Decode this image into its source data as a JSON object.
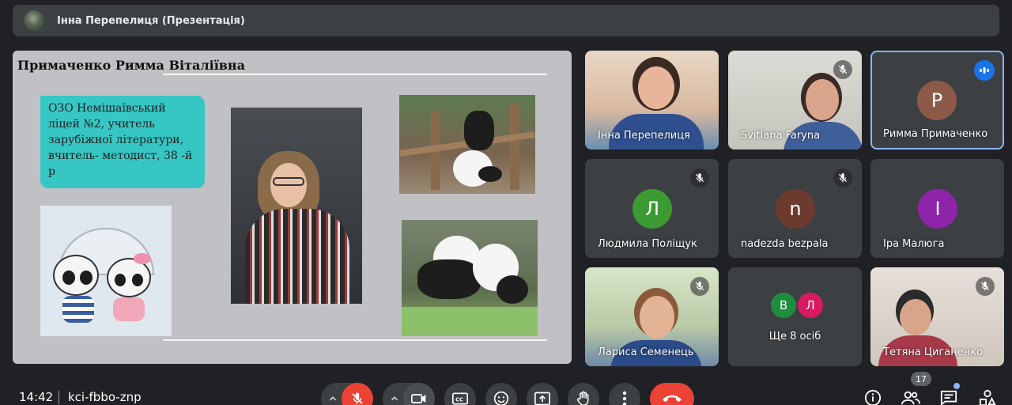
{
  "presenter": {
    "name": "Інна Перепелиця (Презентація)"
  },
  "slide": {
    "title": "Примаченко Римма Віталіївна",
    "info_text": "ОЗО Немішаївський ліцей №2, учитель зарубіжної літератури, вчитель- методист, 38 -й р"
  },
  "participants": [
    {
      "name": "Інна Перепелиця",
      "mic_muted": false,
      "type": "video"
    },
    {
      "name": "Svitlana Faryna",
      "mic_muted": true,
      "type": "video"
    },
    {
      "name": "Римма Примаченко",
      "initial": "P",
      "color": "#8d5a4a",
      "speaking": true,
      "type": "avatar"
    },
    {
      "name": "Людмила Поліщук",
      "initial": "Л",
      "color": "#3c9a32",
      "mic_muted": true,
      "type": "avatar"
    },
    {
      "name": "nadezda bezpala",
      "initial": "n",
      "color": "#6d3a2e",
      "mic_muted": true,
      "type": "avatar"
    },
    {
      "name": "Іра Малюга",
      "initial": "І",
      "color": "#8e24aa",
      "mic_muted": false,
      "type": "avatar"
    },
    {
      "name": "Лариса Семенець",
      "mic_muted": true,
      "type": "video"
    },
    {
      "name": "Ще 8 осіб",
      "type": "more",
      "avatars": [
        {
          "initial": "В",
          "color": "#1e8e3e"
        },
        {
          "initial": "Л",
          "color": "#d81b60"
        }
      ]
    },
    {
      "name": "Тетяна Циганенко",
      "mic_muted": true,
      "type": "video"
    }
  ],
  "toolbar": {
    "time": "14:42",
    "meeting_code": "kci-fbbo-znp",
    "participant_count": "17"
  },
  "colors": {
    "accent": "#8ab4f8",
    "danger": "#ea4335",
    "surface": "#3c4043",
    "background": "#202124"
  }
}
